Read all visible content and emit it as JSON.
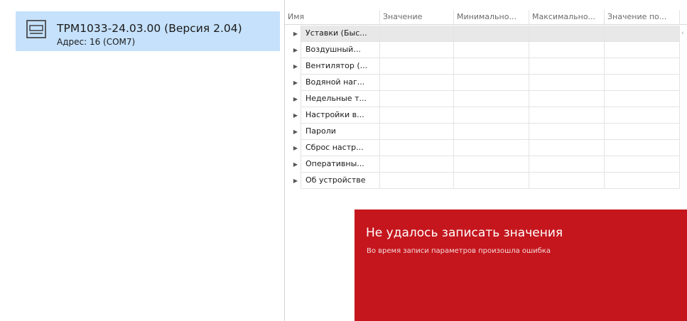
{
  "device": {
    "name": "ТРМ1033-24.03.00 (Версия 2.04)",
    "address": "Адрес: 16 (COM7)",
    "icon": "device-icon"
  },
  "grid": {
    "columns": [
      "Имя",
      "Значение",
      "Минимально...",
      "Максимально...",
      "Значение по..."
    ],
    "rows": [
      {
        "name": "Уставки (Быс..."
      },
      {
        "name": "Воздушный..."
      },
      {
        "name": "Вентилятор (..."
      },
      {
        "name": "Водяной наг..."
      },
      {
        "name": "Недельные т..."
      },
      {
        "name": "Настройки в..."
      },
      {
        "name": "Пароли"
      },
      {
        "name": "Сброс настр..."
      },
      {
        "name": "Оперативны..."
      },
      {
        "name": "Об устройстве"
      }
    ]
  },
  "toast": {
    "title": "Не удалось записать значения",
    "message": "Во время записи параметров произошла ошибка",
    "color": "#c5161d"
  },
  "colors": {
    "selection": "#c5e1fb"
  }
}
